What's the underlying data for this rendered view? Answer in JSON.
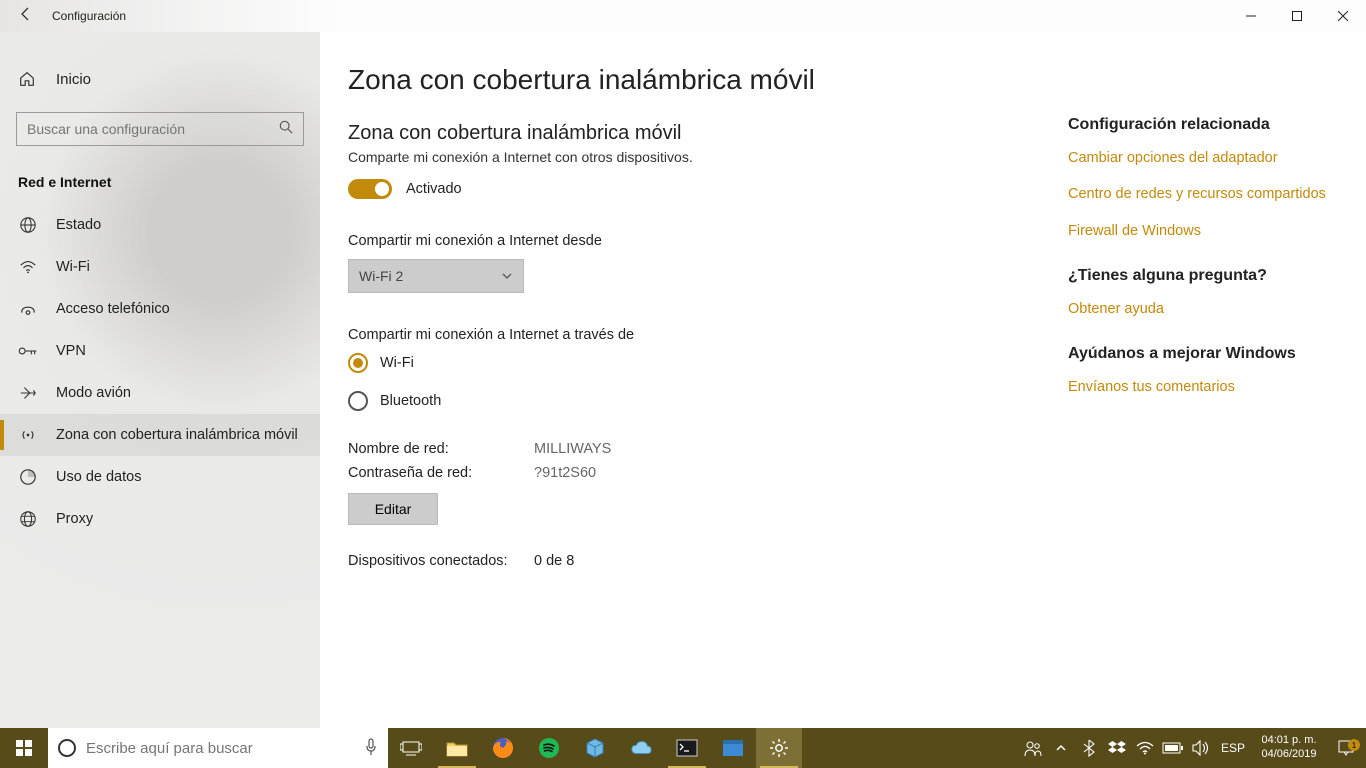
{
  "window": {
    "title": "Configuración",
    "back_icon": "arrow-left"
  },
  "sidebar": {
    "home_label": "Inicio",
    "search_placeholder": "Buscar una configuración",
    "section_title": "Red e Internet",
    "items": [
      {
        "id": "estado",
        "label": "Estado"
      },
      {
        "id": "wifi",
        "label": "Wi-Fi"
      },
      {
        "id": "acceso-telefonico",
        "label": "Acceso telefónico"
      },
      {
        "id": "vpn",
        "label": "VPN"
      },
      {
        "id": "modo-avion",
        "label": "Modo avión"
      },
      {
        "id": "hotspot",
        "label": "Zona con cobertura inalámbrica móvil",
        "selected": true
      },
      {
        "id": "uso-datos",
        "label": "Uso de datos"
      },
      {
        "id": "proxy",
        "label": "Proxy"
      }
    ]
  },
  "page": {
    "heading": "Zona con cobertura inalámbrica móvil",
    "subheading": "Zona con cobertura inalámbrica móvil",
    "subtitle": "Comparte mi conexión a Internet con otros dispositivos.",
    "toggle_on_label": "Activado",
    "share_from_label": "Compartir mi conexión a Internet desde",
    "share_from_value": "Wi-Fi 2",
    "share_over_label": "Compartir mi conexión a Internet a través de",
    "radio_wifi": "Wi-Fi",
    "radio_bluetooth": "Bluetooth",
    "net_name_label": "Nombre de red:",
    "net_name_value": "MILLIWAYS",
    "net_pass_label": "Contraseña de red:",
    "net_pass_value": "?91t2S60",
    "edit_button": "Editar",
    "devices_label": "Dispositivos conectados:",
    "devices_value": "0 de 8"
  },
  "aside": {
    "related_heading": "Configuración relacionada",
    "links": [
      "Cambiar opciones del adaptador",
      "Centro de redes y recursos compartidos",
      "Firewall de Windows"
    ],
    "help_heading": "¿Tienes alguna pregunta?",
    "help_link": "Obtener ayuda",
    "feedback_heading": "Ayúdanos a mejorar Windows",
    "feedback_link": "Envíanos tus comentarios"
  },
  "taskbar": {
    "cortana_placeholder": "Escribe aquí para buscar",
    "lang": "ESP",
    "time": "04:01 p. m.",
    "date": "04/06/2019",
    "notif_count": "1"
  }
}
